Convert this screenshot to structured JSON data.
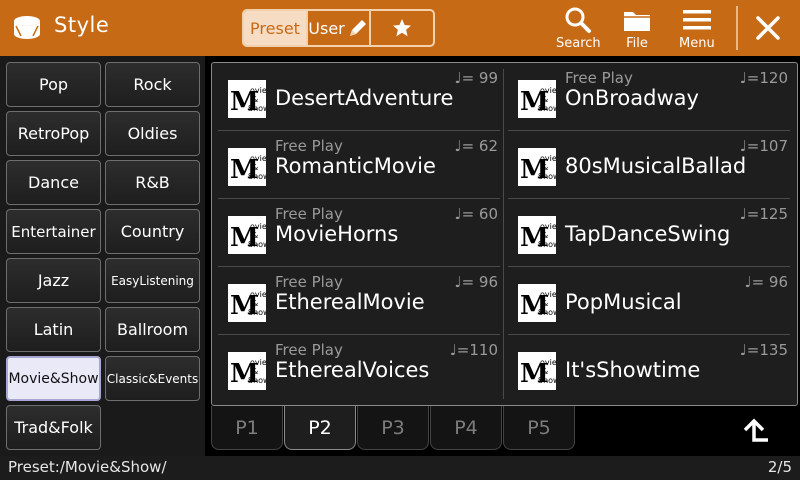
{
  "header": {
    "title": "Style",
    "tabs": {
      "preset": "Preset",
      "user": "User"
    },
    "buttons": {
      "search": "Search",
      "file": "File",
      "menu": "Menu"
    },
    "accent": "#c76a16"
  },
  "categories": [
    "Pop",
    "Rock",
    "RetroPop",
    "Oldies",
    "Dance",
    "R&B",
    "Entertainer",
    "Country",
    "Jazz",
    "EasyListening",
    "Latin",
    "Ballroom",
    "Movie&Show",
    "Classic&Events",
    "Trad&Folk"
  ],
  "active_category": "Movie&Show",
  "styles": [
    {
      "name": "DesertAdventure",
      "sub": "",
      "tempo": "♩= 99"
    },
    {
      "name": "OnBroadway",
      "sub": "Free Play",
      "tempo": "♩=120"
    },
    {
      "name": "RomanticMovie",
      "sub": "Free Play",
      "tempo": "♩= 62"
    },
    {
      "name": "80sMusicalBallad",
      "sub": "",
      "tempo": "♩=107"
    },
    {
      "name": "MovieHorns",
      "sub": "Free Play",
      "tempo": "♩= 60"
    },
    {
      "name": "TapDanceSwing",
      "sub": "",
      "tempo": "♩=125"
    },
    {
      "name": "EtherealMovie",
      "sub": "Free Play",
      "tempo": "♩= 96"
    },
    {
      "name": "PopMusical",
      "sub": "",
      "tempo": "♩= 96"
    },
    {
      "name": "EtherealVoices",
      "sub": "Free Play",
      "tempo": "♩=110"
    },
    {
      "name": "It'sShowtime",
      "sub": "",
      "tempo": "♩=135"
    }
  ],
  "pages": [
    "P1",
    "P2",
    "P3",
    "P4",
    "P5"
  ],
  "active_page": "P2",
  "status": {
    "path": "Preset:/Movie&Show/",
    "page": "2/5"
  }
}
